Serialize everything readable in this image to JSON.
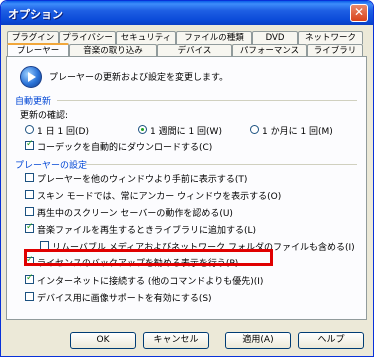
{
  "window": {
    "title": "オプション",
    "close": "✕"
  },
  "tabs_top": [
    "プラグイン",
    "プライバシー",
    "セキュリティ",
    "ファイルの種類",
    "DVD",
    "ネットワーク"
  ],
  "tabs_bottom": [
    "プレーヤー",
    "音楽の取り込み",
    "デバイス",
    "パフォーマンス",
    "ライブラリ"
  ],
  "active_tab": "プレーヤー",
  "header_text": "プレーヤーの更新および設定を変更します。",
  "auto_update": {
    "title": "自動更新",
    "check_label": "更新の確認:",
    "options": [
      "1 日 1 回(D)",
      "1 週間に 1 回(W)",
      "1 か月に 1 回(M)"
    ],
    "selected": "1 週間に 1 回(W)",
    "codec_label": "コーデックを自動的にダウンロードする(C)",
    "codec_checked": true
  },
  "player_settings": {
    "title": "プレーヤーの設定",
    "items": [
      {
        "label": "プレーヤーを他のウィンドウより手前に表示する(T)",
        "checked": false
      },
      {
        "label": "スキン モードでは、常にアンカー ウィンドウを表示する(O)",
        "checked": false
      },
      {
        "label": "再生中のスクリーン セーバーの動作を認める(U)",
        "checked": false
      },
      {
        "label": "音楽ファイルを再生するときライブラリに追加する(L)",
        "checked": true
      },
      {
        "label": "リムーバブル メディアおよびネットワーク フォルダのファイルも含める(I)",
        "checked": false
      },
      {
        "label": "ライセンスのバックアップを勧める表示を行う(P)",
        "checked": true
      },
      {
        "label": "インターネットに接続する (他のコマンドよりも優先)(I)",
        "checked": true
      },
      {
        "label": "デバイス用に画像サポートを有効にする(S)",
        "checked": false
      }
    ]
  },
  "buttons": {
    "ok": "OK",
    "cancel": "キャンセル",
    "apply": "適用(A)",
    "help": "ヘルプ"
  }
}
